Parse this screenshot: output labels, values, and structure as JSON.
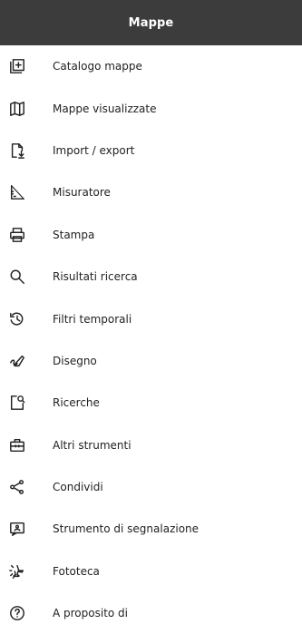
{
  "header": {
    "title": "Mappe"
  },
  "menu": [
    {
      "label": "Catalogo mappe",
      "icon": "catalog-add-icon"
    },
    {
      "label": "Mappe visualizzate",
      "icon": "map-icon"
    },
    {
      "label": "Import / export",
      "icon": "file-import-icon"
    },
    {
      "label": "Misuratore",
      "icon": "ruler-angle-icon"
    },
    {
      "label": "Stampa",
      "icon": "printer-icon"
    },
    {
      "label": "Risultati ricerca",
      "icon": "search-icon"
    },
    {
      "label": "Filtri temporali",
      "icon": "history-icon"
    },
    {
      "label": "Disegno",
      "icon": "draw-icon"
    },
    {
      "label": "Ricerche",
      "icon": "search-document-icon"
    },
    {
      "label": "Altri strumenti",
      "icon": "toolbox-icon"
    },
    {
      "label": "Condividi",
      "icon": "share-icon"
    },
    {
      "label": "Strumento di segnalazione",
      "icon": "report-icon"
    },
    {
      "label": "Fototeca",
      "icon": "aerial-photo-icon"
    },
    {
      "label": "A proposito di",
      "icon": "help-circle-icon"
    }
  ]
}
